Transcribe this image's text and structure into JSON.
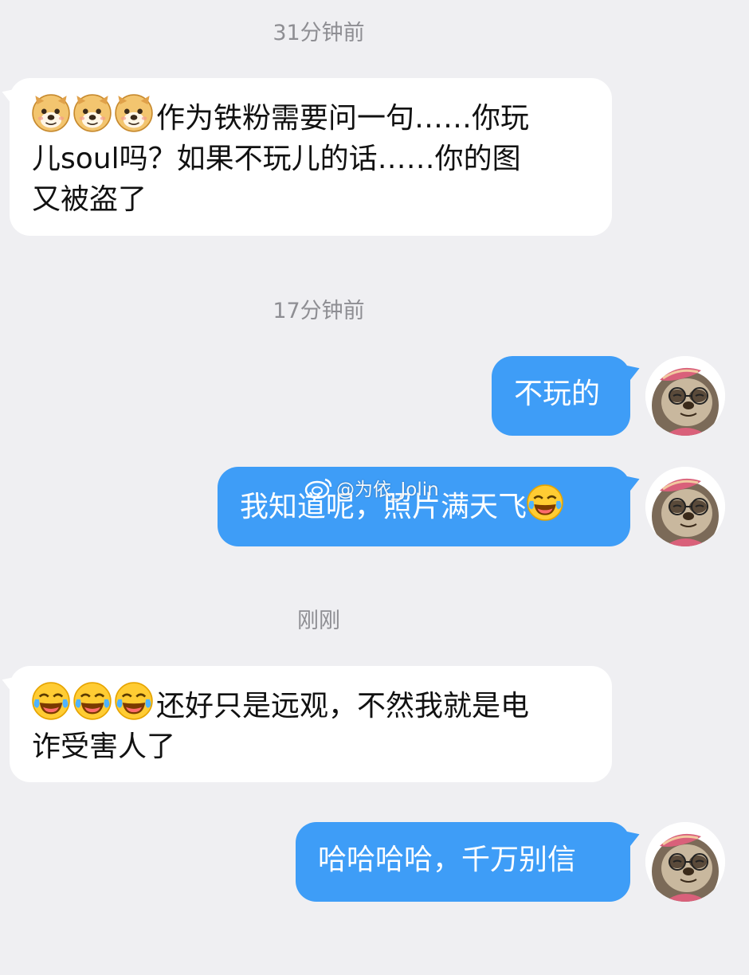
{
  "messages": [
    {
      "type": "timestamp",
      "text": "31分钟前"
    },
    {
      "type": "incoming",
      "emoji": [
        "doge-icon",
        "doge-icon",
        "doge-icon"
      ],
      "lines": [
        "作为铁粉需要问一句……你玩",
        "儿soul吗？如果不玩儿的话……你的图",
        "又被盗了"
      ]
    },
    {
      "type": "timestamp",
      "text": "17分钟前"
    },
    {
      "type": "outgoing",
      "text": "不玩的"
    },
    {
      "type": "outgoing",
      "text": "我知道呢，照片满天飞",
      "emoji_after": "tears-of-joy-icon"
    },
    {
      "type": "timestamp",
      "text": "刚刚"
    },
    {
      "type": "incoming",
      "emoji": [
        "tears-of-joy-icon",
        "tears-of-joy-icon",
        "tears-of-joy-icon"
      ],
      "lines": [
        "还好只是远观，不然我就是电",
        "诈受害人了"
      ]
    },
    {
      "type": "outgoing",
      "text": "哈哈哈哈，千万别信"
    }
  ],
  "watermark": {
    "text": "@为依_Jolin",
    "icon": "weibo-icon"
  },
  "avatar": {
    "icon": "sloth-avatar-icon"
  },
  "colors": {
    "background": "#efeff2",
    "outgoing_bubble": "#3e9df7",
    "incoming_bubble": "#ffffff",
    "timestamp": "#8e8e93"
  }
}
